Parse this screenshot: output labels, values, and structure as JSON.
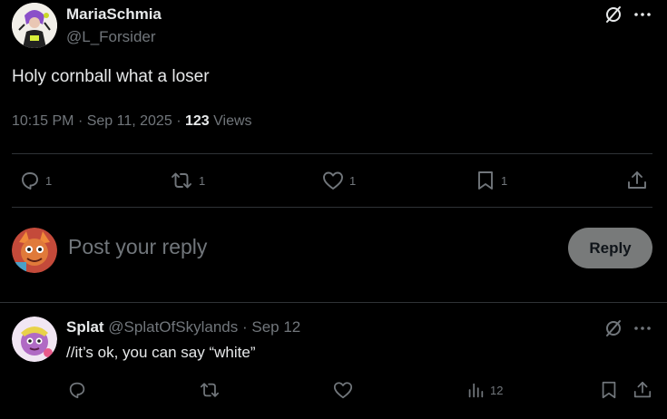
{
  "main_post": {
    "display_name": "MariaSchmia",
    "handle": "@L_Forsider",
    "text": "Holy cornball what a loser",
    "time": "10:15 PM",
    "date": "Sep 11, 2025",
    "views_count": "123",
    "views_label": "Views",
    "dot": "·",
    "stats": {
      "replies": "1",
      "reposts": "1",
      "likes": "1",
      "bookmarks": "1"
    }
  },
  "composer": {
    "placeholder": "Post your reply",
    "button": "Reply"
  },
  "reply_post": {
    "display_name": "Splat",
    "handle": "@SplatOfSkylands",
    "dot": "·",
    "date": "Sep 12",
    "text": "//it’s ok, you can say “white”",
    "stats": {
      "views": "12"
    }
  },
  "colors": {
    "background": "#000000",
    "text": "#e7e9ea",
    "muted": "#71767b",
    "divider": "#2f3336",
    "button": "#787a7a"
  },
  "icons": [
    "grok-icon",
    "more-icon",
    "reply-icon",
    "repost-icon",
    "like-icon",
    "bookmark-icon",
    "share-icon",
    "views-icon"
  ]
}
